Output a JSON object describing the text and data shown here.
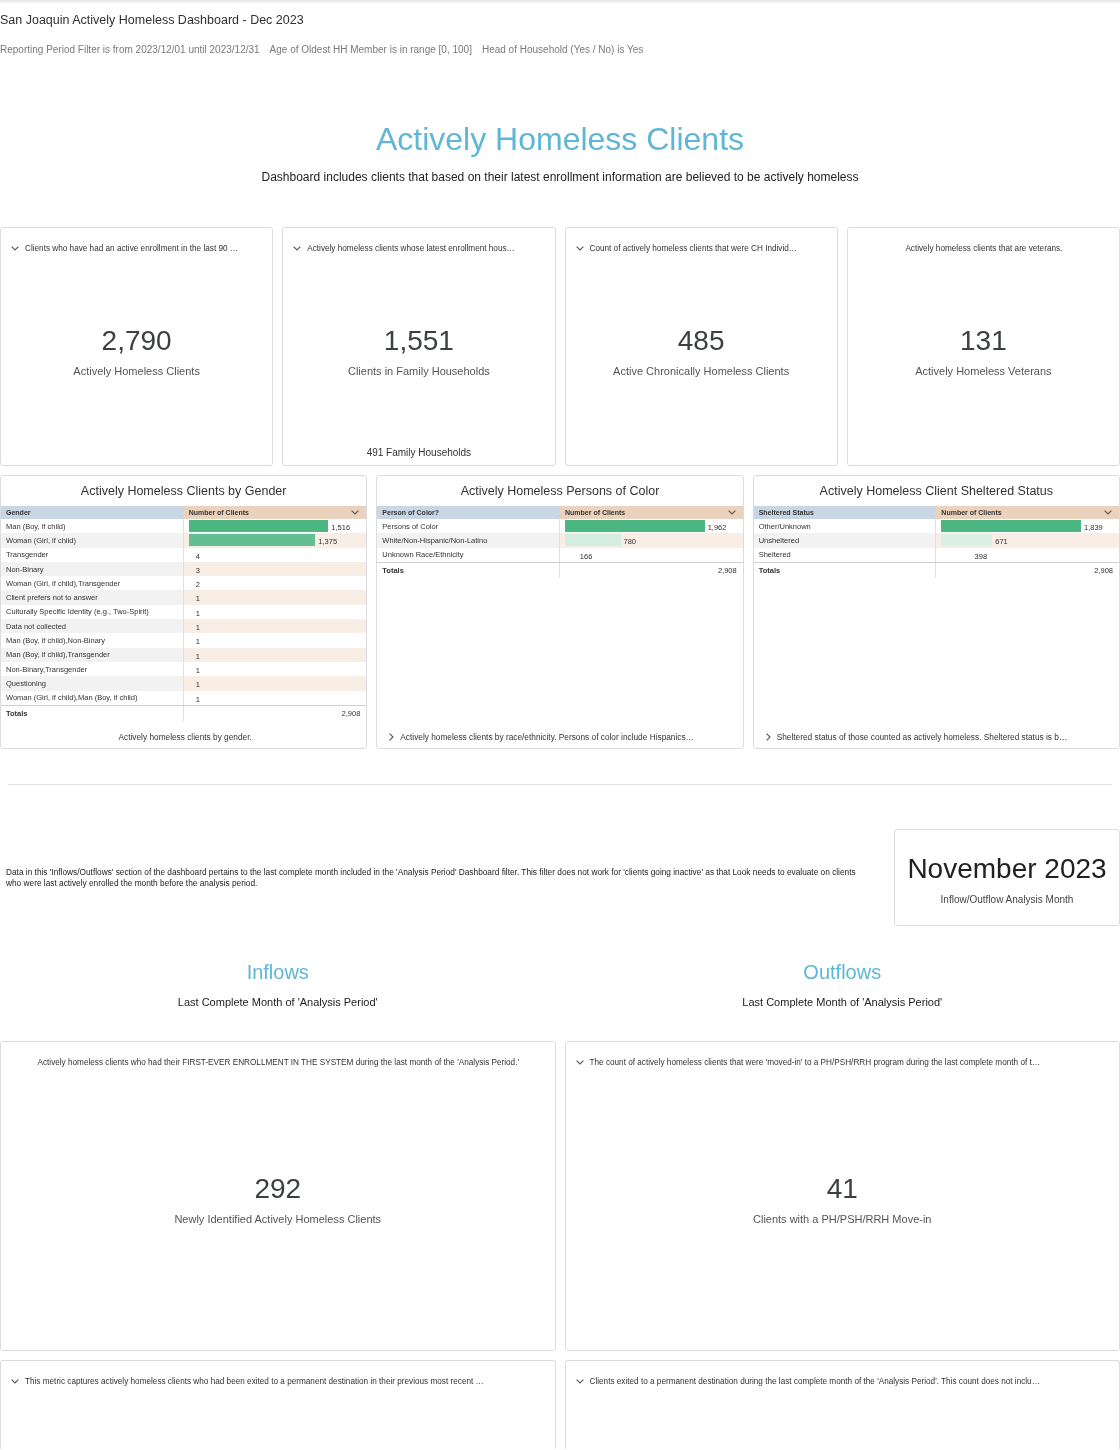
{
  "dashboard": {
    "title": "San Joaquin Actively Homeless Dashboard - Dec 2023",
    "filters": [
      "Reporting Period Filter is from 2023/12/01 until 2023/12/31",
      "Age of Oldest HH Member is in range [0, 100]",
      "Head of Household (Yes / No) is Yes"
    ]
  },
  "overview": {
    "heading": "Actively Homeless Clients",
    "subtitle": "Dashboard includes clients that based on their latest enrollment information are believed to be actively homeless"
  },
  "kpi_cards": [
    {
      "description": {
        "text": "Clients who have had an active enrollment in the last 90 …",
        "kind": "dropdown"
      },
      "value": "2,790",
      "label": "Actively Homeless Clients"
    },
    {
      "description": {
        "text": "Actively homeless clients whose latest enrollment hous…",
        "kind": "dropdown"
      },
      "value": "1,551",
      "label": "Clients in Family Households",
      "footnote": "491 Family Households"
    },
    {
      "description": {
        "text": "Count of actively homeless clients that were CH Individ…",
        "kind": "dropdown"
      },
      "value": "485",
      "label": "Active Chronically Homeless Clients"
    },
    {
      "description": {
        "text": "Actively homeless clients that are veterans.",
        "kind": "plain"
      },
      "value": "131",
      "label": "Actively Homeless Veterans"
    }
  ],
  "table_cards": [
    {
      "title": "Actively Homeless Clients by Gender",
      "columns": [
        "Gender",
        "Number of Clients"
      ],
      "rows": [
        {
          "label": "Man (Boy, if child)",
          "value": "1,516"
        },
        {
          "label": "Woman (Girl, if child)",
          "value": "1,375"
        },
        {
          "label": "Transgender",
          "value": "4"
        },
        {
          "label": "Non-Binary",
          "value": "3"
        },
        {
          "label": "Woman (Girl, if child),Transgender",
          "value": "2"
        },
        {
          "label": "Client prefers not to answer",
          "value": "1"
        },
        {
          "label": "Culturally Specific Identity (e.g., Two-Spirit)",
          "value": "1"
        },
        {
          "label": "Data not collected",
          "value": "1"
        },
        {
          "label": "Man (Boy, if child),Non-Binary",
          "value": "1"
        },
        {
          "label": "Man (Boy, if child),Transgender",
          "value": "1"
        },
        {
          "label": "Non-Binary,Transgender",
          "value": "1"
        },
        {
          "label": "Questioning",
          "value": "1"
        },
        {
          "label": "Woman (Girl, if child),Man (Boy, if child)",
          "value": "1"
        }
      ],
      "totals": {
        "label": "Totals",
        "value": "2,908"
      },
      "description": {
        "text": "Actively homeless clients by gender.",
        "kind": "plain"
      }
    },
    {
      "title": "Actively Homeless Persons of Color",
      "columns": [
        "Person of Color?",
        "Number of Clients"
      ],
      "rows": [
        {
          "label": "Persons of Color",
          "value": "1,962"
        },
        {
          "label": "White/Non-Hispanic/Non-Latino",
          "value": "780"
        },
        {
          "label": "Unknown Race/Ethnicity",
          "value": "166"
        }
      ],
      "totals": {
        "label": "Totals",
        "value": "2,908"
      },
      "description": {
        "text": "Actively homeless clients by race/ethnicity. Persons of color include Hispanics…",
        "kind": "disclosure"
      }
    },
    {
      "title": "Actively Homeless Client Sheltered Status",
      "columns": [
        "Sheltered Status",
        "Number of Clients"
      ],
      "rows": [
        {
          "label": "Other/Unknown",
          "value": "1,839"
        },
        {
          "label": "Unsheltered",
          "value": "671"
        },
        {
          "label": "Sheltered",
          "value": "398"
        }
      ],
      "totals": {
        "label": "Totals",
        "value": "2,908"
      },
      "description": {
        "text": "Sheltered status of those counted as actively homeless. Sheltered status is b…",
        "kind": "disclosure"
      }
    }
  ],
  "flow_intro": {
    "text": "Data in this 'Inflows/Outflows' section of the dashboard pertains to the last complete month included in the 'Analysis Period' Dashboard filter. This filter does not work for 'clients going inactive' as that Look needs to evaluate on clients who were last actively enrolled the month before the analysis period."
  },
  "analysis_month": {
    "value": "November 2023",
    "label": "Inflow/Outflow Analysis Month"
  },
  "flow_columns": [
    {
      "heading": "Inflows",
      "subtitle": "Last Complete Month of 'Analysis Period'",
      "cards": [
        {
          "description": {
            "text": "Actively homeless clients who had their FIRST-EVER ENROLLMENT IN THE SYSTEM during the last month of the 'Analysis Period.'",
            "kind": "plain"
          },
          "value": "292",
          "label": "Newly Identified Actively Homeless Clients"
        },
        {
          "description": {
            "text": "This metric captures actively homeless clients who had been exited to a permanent destination in their previous most recent …",
            "kind": "dropdown"
          }
        }
      ]
    },
    {
      "heading": "Outflows",
      "subtitle": "Last Complete Month of 'Analysis Period'",
      "cards": [
        {
          "description": {
            "text": "The count of actively homeless clients that were 'moved-in' to a PH/PSH/RRH program during the last complete month of t…",
            "kind": "dropdown"
          },
          "value": "41",
          "label": "Clients with a PH/PSH/RRH Move-in"
        },
        {
          "description": {
            "text": "Clients exited to a permanent destination during the last complete month of the 'Analysis Period'. This count does not inclu…",
            "kind": "dropdown"
          }
        }
      ]
    }
  ]
}
